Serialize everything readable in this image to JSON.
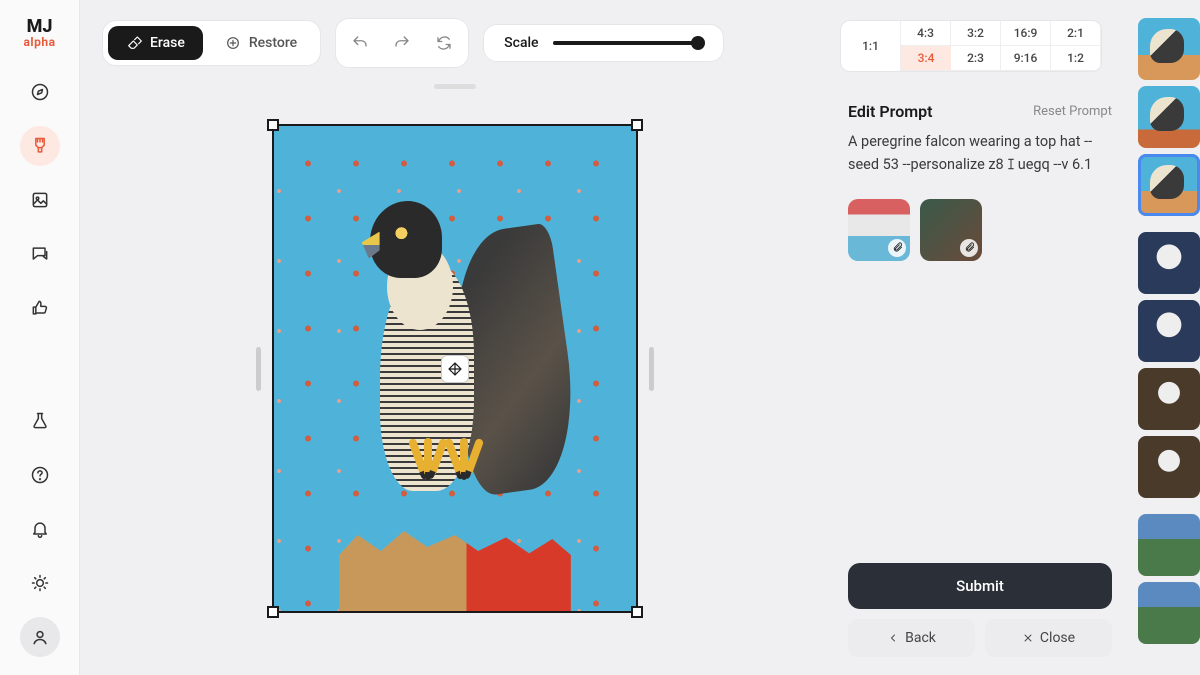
{
  "app": {
    "logo_main": "MJ",
    "logo_sub": "alpha"
  },
  "sidebar_left": {
    "top_icons": [
      "compass",
      "brush",
      "image",
      "chat",
      "thumbs-up"
    ],
    "bottom_icons": [
      "flask",
      "help",
      "bell",
      "sun",
      "user"
    ],
    "active_index": 1
  },
  "toolbar": {
    "erase_label": "Erase",
    "restore_label": "Restore",
    "scale_label": "Scale",
    "scale_value": 1.0
  },
  "aspect_ratios": {
    "fixed": "1:1",
    "row1": [
      "4:3",
      "3:2",
      "16:9",
      "2:1"
    ],
    "row2": [
      "3:4",
      "2:3",
      "9:16",
      "1:2"
    ],
    "selected": "3:4"
  },
  "canvas": {
    "subject": "peregrine falcon illustration on wooden perch, sky-blue background with red petals"
  },
  "edit_panel": {
    "title": "Edit Prompt",
    "reset": "Reset Prompt",
    "prompt_pre": "A peregrine falcon wearing a top hat --seed 53 --personalize z8",
    "prompt_post": "uegq --v 6.1",
    "references": [
      {
        "name": "reference-image-1"
      },
      {
        "name": "reference-image-2"
      }
    ],
    "submit": "Submit",
    "back": "Back",
    "close": "Close"
  },
  "rail_thumbs": [
    {
      "kind": "sky"
    },
    {
      "kind": "sky2"
    },
    {
      "kind": "sky",
      "active": true
    },
    {
      "kind": "owl"
    },
    {
      "kind": "owl"
    },
    {
      "kind": "owl2"
    },
    {
      "kind": "owl2"
    },
    {
      "kind": "house"
    },
    {
      "kind": "house"
    }
  ]
}
